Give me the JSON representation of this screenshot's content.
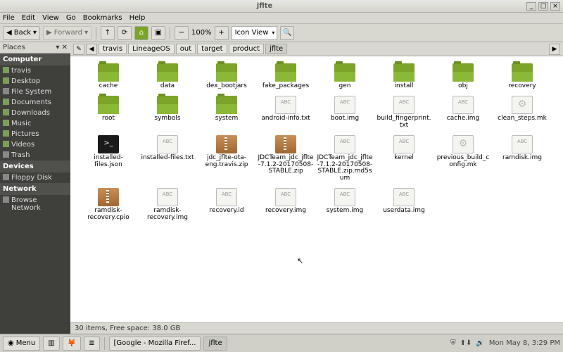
{
  "window": {
    "title": "jflte"
  },
  "window_controls": {
    "min": "_",
    "max": "□",
    "close": "×"
  },
  "menubar": [
    "File",
    "Edit",
    "View",
    "Go",
    "Bookmarks",
    "Help"
  ],
  "toolbar": {
    "back": "Back",
    "forward": "Forward",
    "up": "↑",
    "reload": "⟳",
    "home": "⌂",
    "computer": "▣",
    "zoom_out": "−",
    "zoom": "100%",
    "zoom_in": "+",
    "view_mode": "Icon View",
    "search": "🔍"
  },
  "sidebar": {
    "header": "Places",
    "groups": [
      {
        "label": "Computer",
        "items": [
          "travis",
          "Desktop",
          "File System",
          "Documents",
          "Downloads",
          "Music",
          "Pictures",
          "Videos",
          "Trash"
        ]
      },
      {
        "label": "Devices",
        "items": [
          "Floppy Disk"
        ]
      },
      {
        "label": "Network",
        "items": [
          "Browse Network"
        ]
      }
    ]
  },
  "path": [
    "travis",
    "LineageOS",
    "out",
    "target",
    "product",
    "jflte"
  ],
  "files": [
    {
      "n": "cache",
      "t": "folder"
    },
    {
      "n": "data",
      "t": "folder"
    },
    {
      "n": "dex_bootjars",
      "t": "folder"
    },
    {
      "n": "fake_packages",
      "t": "folder"
    },
    {
      "n": "gen",
      "t": "folder"
    },
    {
      "n": "install",
      "t": "folder"
    },
    {
      "n": "obj",
      "t": "folder"
    },
    {
      "n": "recovery",
      "t": "folder"
    },
    {
      "n": "root",
      "t": "folder"
    },
    {
      "n": "symbols",
      "t": "folder"
    },
    {
      "n": "system",
      "t": "folder"
    },
    {
      "n": "android-info.txt",
      "t": "file-txt"
    },
    {
      "n": "boot.img",
      "t": "file-txt"
    },
    {
      "n": "build_fingerprint.txt",
      "t": "file-txt"
    },
    {
      "n": "cache.img",
      "t": "file-txt"
    },
    {
      "n": "clean_steps.mk",
      "t": "file-gear"
    },
    {
      "n": "installed-files.json",
      "t": "file-bin"
    },
    {
      "n": "installed-files.txt",
      "t": "file-txt"
    },
    {
      "n": "jdc_jflte-ota-eng.travis.zip",
      "t": "file-zip"
    },
    {
      "n": "JDCTeam_jdc_jflte-7.1.2-20170508-STABLE.zip",
      "t": "file-zip"
    },
    {
      "n": "JDCTeam_jdc_jflte-7.1.2-20170508-STABLE.zip.md5sum",
      "t": "file-txt"
    },
    {
      "n": "kernel",
      "t": "file-txt"
    },
    {
      "n": "previous_build_config.mk",
      "t": "file-gear"
    },
    {
      "n": "ramdisk.img",
      "t": "file-txt"
    },
    {
      "n": "ramdisk-recovery.cpio",
      "t": "file-zip"
    },
    {
      "n": "ramdisk-recovery.img",
      "t": "file-txt"
    },
    {
      "n": "recovery.id",
      "t": "file-txt"
    },
    {
      "n": "recovery.img",
      "t": "file-txt"
    },
    {
      "n": "system.img",
      "t": "file-txt"
    },
    {
      "n": "userdata.img",
      "t": "file-txt"
    }
  ],
  "status": "30 items, Free space: 38.0 GB",
  "taskbar": {
    "menu": "Menu",
    "tasks": [
      "[Google - Mozilla Firef...",
      "jflte"
    ],
    "clock": "Mon May  8,  3:29 PM"
  }
}
